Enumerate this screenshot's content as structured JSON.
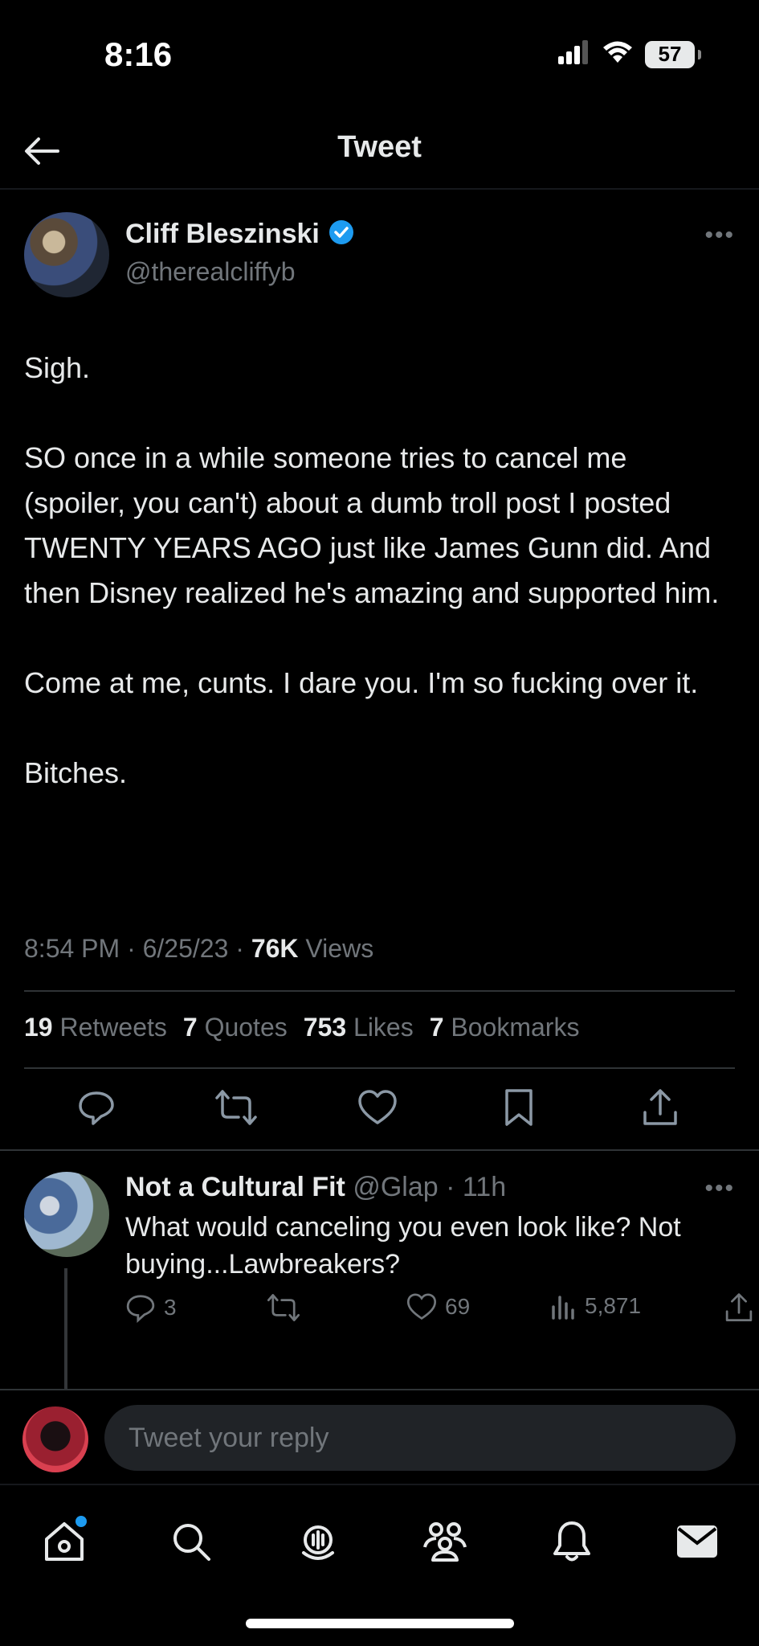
{
  "status_bar": {
    "time": "8:16",
    "battery": "57"
  },
  "header": {
    "title": "Tweet"
  },
  "tweet": {
    "author_name": "Cliff Bleszinski",
    "author_handle": "@therealcliffyb",
    "paragraphs": [
      "Sigh.",
      "SO once in a while someone tries to cancel me (spoiler, you can't) about a dumb troll post I posted TWENTY YEARS AGO just like James Gunn did. And then Disney realized he's amazing and supported him.",
      "Come at me, cunts. I dare you. I'm so fucking over it.",
      "Bitches."
    ],
    "time": "8:54 PM",
    "date": "6/25/23",
    "views_count": "76K",
    "views_label": "Views",
    "retweets_count": "19",
    "retweets_label": "Retweets",
    "quotes_count": "7",
    "quotes_label": "Quotes",
    "likes_count": "753",
    "likes_label": "Likes",
    "bookmarks_count": "7",
    "bookmarks_label": "Bookmarks"
  },
  "reply": {
    "name": "Not a Cultural Fit",
    "handle": "@Glap",
    "age": "11h",
    "text": "What would canceling you even look like? Not buying...Lawbreakers?",
    "replies": "3",
    "likes": "69",
    "views": "5,871"
  },
  "compose": {
    "placeholder": "Tweet your reply"
  },
  "colors": {
    "accent": "#1d9bf0",
    "muted": "#71767b",
    "background": "#000000"
  }
}
